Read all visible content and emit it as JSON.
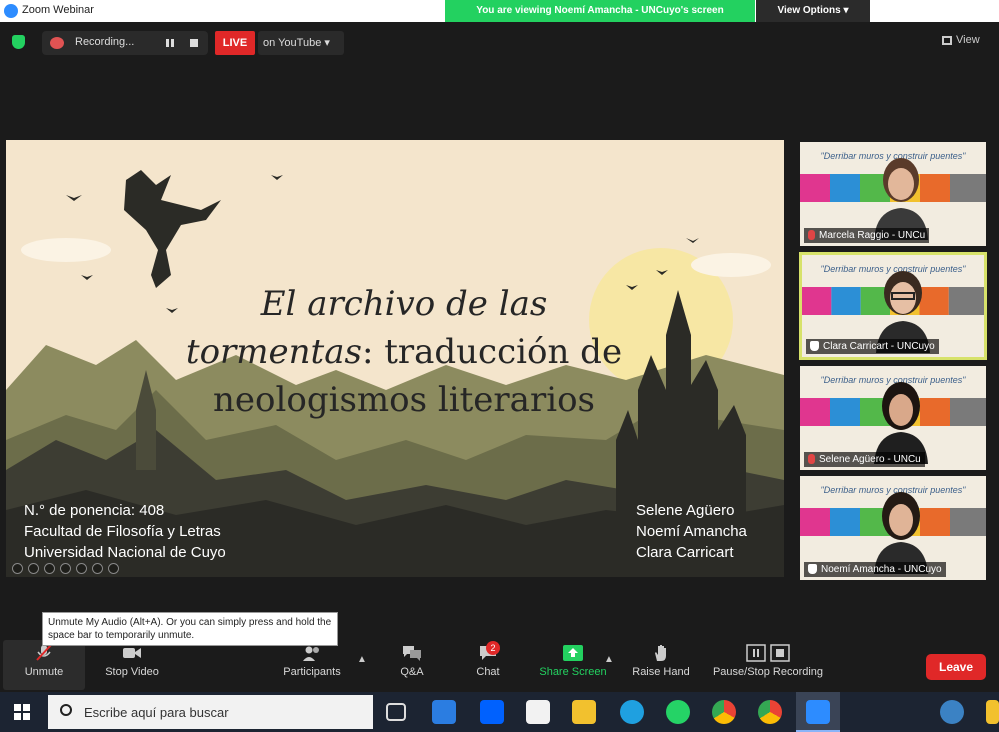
{
  "window": {
    "title": "Zoom Webinar"
  },
  "banner": {
    "text": "You are viewing Noemí Amancha - UNCuyo's screen",
    "view_options": "View Options ▾"
  },
  "topbar": {
    "recording_label": "Recording...",
    "live_badge": "LIVE",
    "live_target": "on YouTube ▾",
    "view_label": "View"
  },
  "slide": {
    "title_italic_1": "El archivo de las",
    "title_italic_2": "tormentas",
    "title_rest_2": ": traducción de",
    "title_line_3": "neologismos literarios",
    "info": [
      "N.° de ponencia: 408",
      "Facultad de Filosofía y Letras",
      "Universidad Nacional de Cuyo"
    ],
    "authors": [
      "Selene Agüero",
      "Noemí Amancha",
      "Clara Carricart"
    ]
  },
  "participants": [
    {
      "quote": "\"Derribar muros y construir puentes\"",
      "name": "Marcela Raggio - UNCu"
    },
    {
      "quote": "\"Derribar muros y construir puentes\"",
      "name": "Clara Carricart - UNCuyo"
    },
    {
      "quote": "\"Derribar muros y construir puentes\"",
      "name": "Selene Agüero - UNCu"
    },
    {
      "quote": "\"Derribar muros y construir puentes\"",
      "name": "Noemí Amancha - UNCuyo"
    }
  ],
  "tooltip": {
    "text": "Unmute My Audio (Alt+A). Or you can simply press and hold the space bar to temporarily unmute."
  },
  "toolbar": {
    "unmute": "Unmute",
    "stop_video": "Stop Video",
    "participants": "Participants",
    "qa": "Q&A",
    "chat": "Chat",
    "chat_badge": "2",
    "share_screen": "Share Screen",
    "raise_hand": "Raise Hand",
    "pause_recording": "Pause/Stop Recording",
    "leave": "Leave"
  },
  "taskbar": {
    "search_placeholder": "Escribe aquí para buscar"
  },
  "colors": {
    "banner": "#23d160",
    "live": "#e02828",
    "leave": "#e02828",
    "share": "#23d160",
    "slide_bg": "#f4e5cc"
  }
}
